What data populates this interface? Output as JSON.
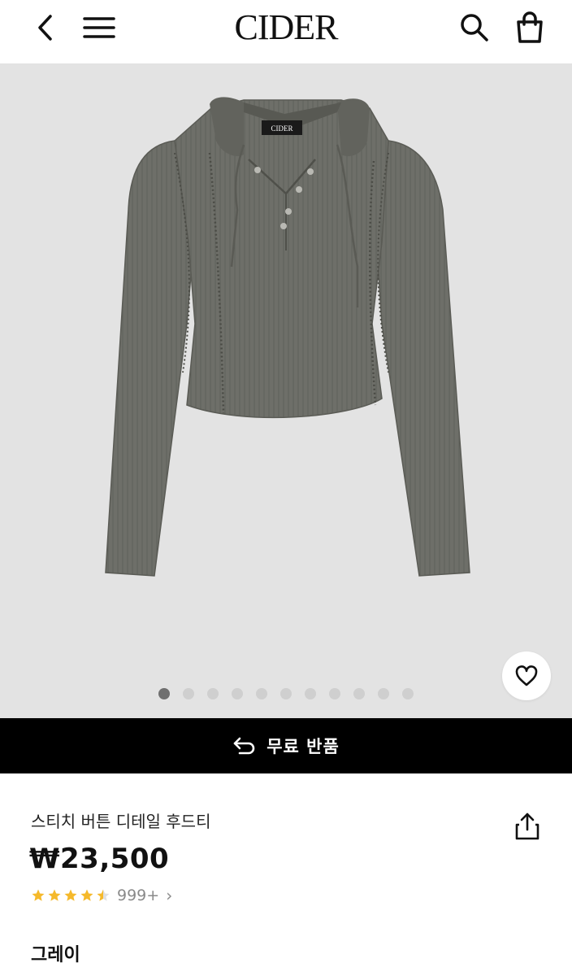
{
  "header": {
    "logo": "CIDER",
    "back_icon": "back-chevron-icon",
    "menu_icon": "hamburger-menu-icon",
    "search_icon": "search-icon",
    "bag_icon": "shopping-bag-icon"
  },
  "product_image": {
    "garment_color": "#6e6f69",
    "background": "#e3e3e3",
    "label_text": "CIDER"
  },
  "carousel": {
    "total": 11,
    "active_index": 0
  },
  "wishlist_icon": "heart-outline-icon",
  "banner": {
    "icon": "return-arrow-icon",
    "text": "무료 반품"
  },
  "product": {
    "title": "스티치 버튼 디테일 후드티",
    "price": "₩23,500",
    "rating": 4.5,
    "review_count": "999+",
    "share_icon": "share-icon",
    "color_label": "그레이"
  },
  "colors": {
    "star": "#f5b92b",
    "banner_bg": "#000000"
  }
}
